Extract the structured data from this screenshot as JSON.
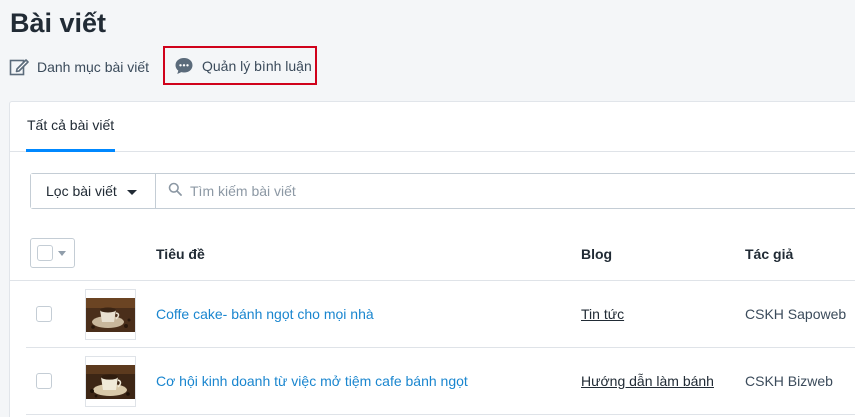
{
  "page": {
    "title": "Bài viết"
  },
  "actions": {
    "categories_label": "Danh mục bài viết",
    "comments_label": "Quản lý bình luận"
  },
  "tabs": [
    {
      "label": "Tất cả bài viết"
    }
  ],
  "filter": {
    "button_label": "Lọc bài viết",
    "search_placeholder": "Tìm kiếm bài viết"
  },
  "table": {
    "columns": {
      "title": "Tiêu đề",
      "blog": "Blog",
      "author": "Tác giả"
    },
    "rows": [
      {
        "title": "Coffe cake- bánh ngọt cho mọi nhà",
        "blog": "Tin tức",
        "author": "CSKH Sapoweb"
      },
      {
        "title": "Cơ hội kinh doanh từ việc mở tiệm cafe bánh ngọt",
        "blog": "Hướng dẫn làm bánh",
        "author": "CSKH Bizweb"
      }
    ]
  },
  "colors": {
    "accent": "#0088ff",
    "link": "#1a86cf",
    "highlight_border": "#d0021b"
  }
}
